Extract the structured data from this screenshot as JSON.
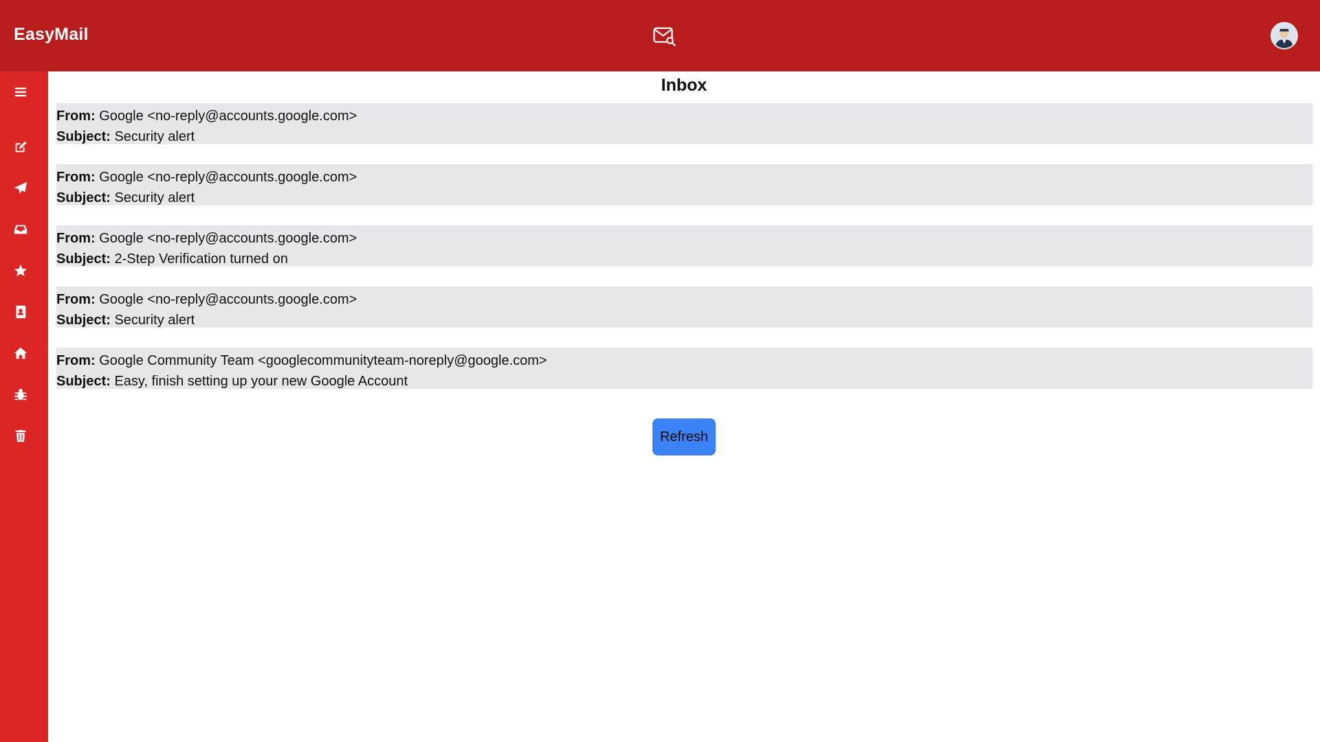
{
  "app": {
    "brand": "EasyMail"
  },
  "header": {
    "icons": [
      "mail-search-icon",
      "user-avatar"
    ]
  },
  "sidebar": {
    "items": [
      {
        "icon": "menu-icon"
      },
      {
        "icon": "compose-icon"
      },
      {
        "icon": "sent-icon"
      },
      {
        "icon": "inbox-icon"
      },
      {
        "icon": "star-icon"
      },
      {
        "icon": "contacts-icon"
      },
      {
        "icon": "home-icon"
      },
      {
        "icon": "spam-icon"
      },
      {
        "icon": "trash-icon"
      }
    ]
  },
  "main": {
    "title": "Inbox",
    "from_label": "From:",
    "subject_label": "Subject:",
    "emails": [
      {
        "from": "Google <no-reply@accounts.google.com>",
        "subject": "Security alert"
      },
      {
        "from": "Google <no-reply@accounts.google.com>",
        "subject": "Security alert"
      },
      {
        "from": "Google <no-reply@accounts.google.com>",
        "subject": "2-Step Verification turned on"
      },
      {
        "from": "Google <no-reply@accounts.google.com>",
        "subject": "Security alert"
      },
      {
        "from": "Google Community Team <googlecommunityteam-noreply@google.com>",
        "subject": "Easy, finish setting up your new Google Account"
      }
    ],
    "refresh_label": "Refresh"
  },
  "colors": {
    "header": "#b91c1c",
    "sidebar": "#dc2626",
    "mail_item_bg": "#e5e7eb",
    "refresh_button": "#3b82f6"
  }
}
